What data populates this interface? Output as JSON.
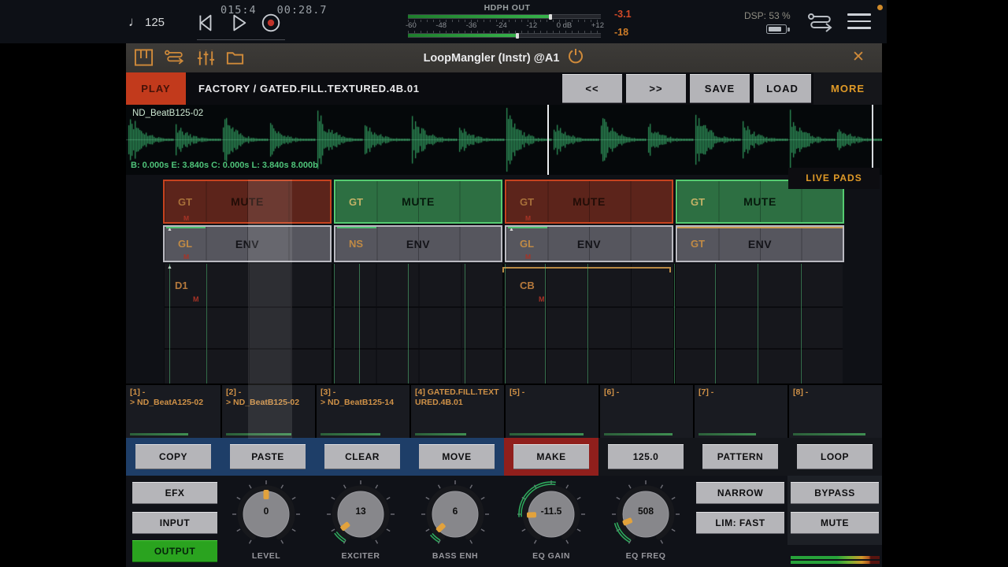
{
  "topbar": {
    "tempo_note": "♩",
    "tempo": "125",
    "time_bars": "015:4",
    "time_clock": "00:28.7",
    "transport_icons": [
      "skip-back-icon",
      "play-icon",
      "record-icon"
    ],
    "meter": {
      "label": "HDPH OUT",
      "ticks": [
        "-60",
        "-48",
        "-36",
        "-24",
        "-12",
        "0 dB",
        "+12"
      ],
      "peak_top": "-3.1",
      "peak_bottom": "-18",
      "fill_top_pct": 73,
      "fill_bottom_pct": 56
    },
    "dsp": "DSP: 53 %",
    "right_icons": [
      "battery-icon",
      "signal-flow-icon",
      "menu-icon",
      "notification-dot"
    ]
  },
  "plugin": {
    "header": {
      "icons": [
        "piano-icon",
        "signal-flow-icon",
        "mixer-icon",
        "folder-icon"
      ],
      "title": "LoopMangler (Instr) @A1",
      "power_icon": "power-icon",
      "close_icon": "✕"
    },
    "preset_bar": {
      "play": "PLAY",
      "path": "FACTORY / GATED.FILL.TEXTURED.4B.01",
      "prev": "<<",
      "next": ">>",
      "save": "SAVE",
      "load": "LOAD",
      "more": "MORE"
    },
    "waveform": {
      "sample_name": "ND_BeatB125-02",
      "info": "B: 0.000s E: 3.840s C: 0.000s L: 3.840s 8.000b"
    },
    "live_pads": "LIVE PADS",
    "pads": {
      "mute_marker": "M",
      "corner_marker": "▲",
      "row1": [
        {
          "tag": "GT",
          "label": "MUTE",
          "color": "red"
        },
        {
          "tag": "GT",
          "label": "MUTE",
          "color": "green"
        },
        {
          "tag": "GT",
          "label": "MUTE",
          "color": "red"
        },
        {
          "tag": "GT",
          "label": "MUTE",
          "color": "green"
        }
      ],
      "row2": [
        {
          "tag": "GL",
          "label": "ENV"
        },
        {
          "tag": "NS",
          "label": "ENV"
        },
        {
          "tag": "GL",
          "label": "ENV"
        },
        {
          "tag": "GT",
          "label": "ENV"
        }
      ],
      "row3": [
        {
          "tag": "D1"
        },
        {
          "tag": "CB"
        }
      ]
    },
    "slots": [
      {
        "label": "[1] -",
        "file": "> ND_BeatA125-02"
      },
      {
        "label": "[2] -",
        "file": "> ND_BeatB125-02"
      },
      {
        "label": "[3] -",
        "file": "> ND_BeatB125-14"
      },
      {
        "label": "[4] GATED.FILL.TEXTURED.4B.01",
        "file": ""
      },
      {
        "label": "[5] -",
        "file": ""
      },
      {
        "label": "[6] -",
        "file": ""
      },
      {
        "label": "[7] -",
        "file": ""
      },
      {
        "label": "[8] -",
        "file": ""
      }
    ],
    "edit_buttons": [
      "COPY",
      "PASTE",
      "CLEAR",
      "MOVE",
      "MAKE",
      "125.0",
      "PATTERN",
      "LOOP"
    ],
    "output": {
      "modes": [
        "EFX",
        "INPUT",
        "OUTPUT"
      ],
      "active_mode": "OUTPUT",
      "knobs": [
        {
          "label": "LEVEL",
          "value": "0"
        },
        {
          "label": "EXCITER",
          "value": "13"
        },
        {
          "label": "BASS ENH",
          "value": "6"
        },
        {
          "label": "EQ GAIN",
          "value": "-11.5"
        },
        {
          "label": "EQ FREQ",
          "value": "508"
        }
      ],
      "buttons": {
        "narrow": "NARROW",
        "limiter": "LIM: FAST",
        "bypass": "BYPASS",
        "mute": "MUTE"
      }
    }
  },
  "colors": {
    "accent_orange": "#d08a3a",
    "play_red": "#c23a1c",
    "pad_red": "#5c241b",
    "pad_red_border": "#c7431f",
    "pad_green": "#2d6f42",
    "pad_green_border": "#55cb71",
    "pad_gray": "#56565e",
    "waveform_green": "#2f9159",
    "meter_green": "#36b14a",
    "output_green": "#2aa31f",
    "navy_panel": "#1e3e68",
    "red_panel": "#901f1c",
    "button_gray": "#b5b5b9"
  }
}
